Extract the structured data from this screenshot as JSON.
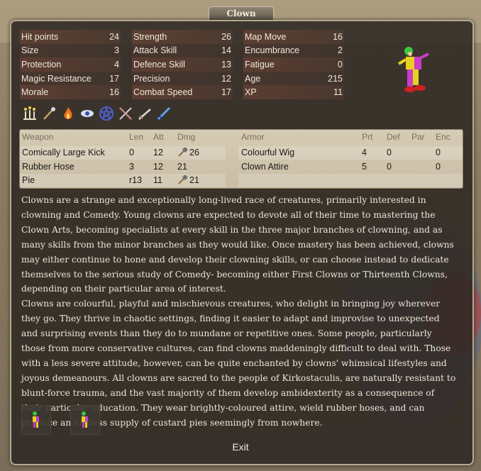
{
  "window": {
    "title": "Clown"
  },
  "stats": {
    "col1": [
      {
        "label": "Hit points",
        "value": "24"
      },
      {
        "label": "Size",
        "value": "3"
      },
      {
        "label": "Protection",
        "value": "4"
      },
      {
        "label": "Magic Resistance",
        "value": "17"
      },
      {
        "label": "Morale",
        "value": "16"
      }
    ],
    "col2": [
      {
        "label": "Strength",
        "value": "26"
      },
      {
        "label": "Attack Skill",
        "value": "14"
      },
      {
        "label": "Defence Skill",
        "value": "13"
      },
      {
        "label": "Precision",
        "value": "12"
      },
      {
        "label": "Combat Speed",
        "value": "17"
      }
    ],
    "col3": [
      {
        "label": "Map Move",
        "value": "16"
      },
      {
        "label": "Encumbrance",
        "value": "2"
      },
      {
        "label": "Fatigue",
        "value": "0"
      },
      {
        "label": "Age",
        "value": "215"
      },
      {
        "label": "XP",
        "value": "11"
      }
    ]
  },
  "ability_icons": [
    "candelabra-icon",
    "wand-icon",
    "fire-icon",
    "eye-icon",
    "pentagram-icon",
    "crossed-swords-icon",
    "sword-icon",
    "blue-sword-icon"
  ],
  "weapons": {
    "headers": {
      "name": "Weapon",
      "len": "Len",
      "att": "Att",
      "dmg": "Dmg"
    },
    "rows": [
      {
        "name": "Comically Large Kick",
        "len": "0",
        "att": "12",
        "dmg": "26",
        "blunt": true
      },
      {
        "name": "Rubber Hose",
        "len": "3",
        "att": "12",
        "dmg": "21",
        "blunt": false
      },
      {
        "name": "Pie",
        "len": "r13",
        "att": "11",
        "dmg": "21",
        "blunt": true
      }
    ]
  },
  "armor": {
    "headers": {
      "name": "Armor",
      "prt": "Prt",
      "def": "Def",
      "par": "Par",
      "enc": "Enc"
    },
    "rows": [
      {
        "name": "Colourful Wig",
        "prt": "4",
        "def": "0",
        "par": "",
        "enc": "0"
      },
      {
        "name": "Clown Attire",
        "prt": "5",
        "def": "0",
        "par": "",
        "enc": "0"
      }
    ]
  },
  "description": [
    "Clowns are a strange and exceptionally long-lived race of creatures, primarily interested in clowning and Comedy. Young clowns are expected to devote all of their time to mastering the Clown Arts, becoming specialists at every skill in the three major branches of clowning, and as many skills from the minor branches as they would like. Once mastery has been achieved, clowns may either continue to hone and develop their clowning skills, or can choose instead to dedicate themselves to the serious study of Comedy- becoming either First Clowns or Thirteenth Clowns, depending on their particular area of interest.",
    "Clowns are colourful, playful and mischievous creatures, who delight in bringing joy wherever they go. They thrive in chaotic settings, finding it easier to adapt and improvise to unexpected and surprising events than they do to mundane or repetitive ones. Some people, particularly those from more conservative cultures, can find clowns maddeningly difficult to deal with. Those with a less severe attitude, however, can be quite enchanted by clowns' whimsical lifestyles and joyous demeanours. All clowns are sacred to the people of Kirkostaculis, are naturally resistant to blunt-force trauma, and the vast majority of them develop ambidexterity as a consequence of their particular education. They wear brightly-coloured attire, wield rubber hoses, and can produce an endless supply of custard pies seemingly from nowhere."
  ],
  "buttons": {
    "exit": "Exit"
  },
  "colors": {
    "panel": "#2d2823",
    "stat_stripe": "#784637",
    "table_bg": "#d6cbb4",
    "text": "#efe8d8"
  }
}
